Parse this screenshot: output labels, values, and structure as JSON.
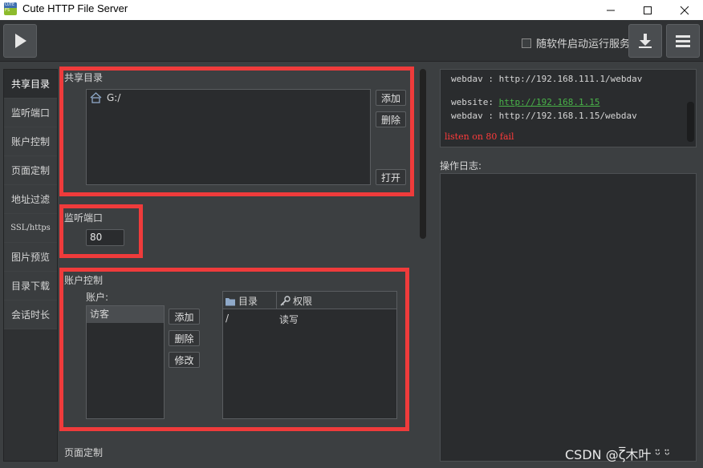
{
  "window": {
    "title": "Cute HTTP File Server",
    "icon_text": "CUTE FS",
    "minimize_glyph": "—",
    "maximize_glyph": "☐",
    "close_glyph": "✕"
  },
  "toolbar": {
    "autostart_label": "随软件启动运行服务",
    "autostart_checked": false,
    "play_icon": "play-icon",
    "download_icon": "download-icon",
    "menu_icon": "hamburger-menu-icon"
  },
  "sidebar": {
    "items": [
      {
        "label": "共享目录"
      },
      {
        "label": "监听端口"
      },
      {
        "label": "账户控制"
      },
      {
        "label": "页面定制"
      },
      {
        "label": "地址过滤"
      },
      {
        "label": "SSL/https"
      },
      {
        "label": "图片预览"
      },
      {
        "label": "目录下载"
      },
      {
        "label": "会话时长"
      }
    ],
    "active_index": 0
  },
  "shared_dirs": {
    "title": "共享目录",
    "entries": [
      {
        "icon": "home-icon",
        "path": "G:/"
      }
    ],
    "add_label": "添加",
    "delete_label": "删除",
    "open_label": "打开"
  },
  "listen_port": {
    "title": "监听端口",
    "value": "80"
  },
  "accounts": {
    "title": "账户控制",
    "accounts_label": "账户:",
    "users": [
      "访客"
    ],
    "add_label": "添加",
    "delete_label": "删除",
    "edit_label": "修改",
    "columns": [
      {
        "icon": "folder-icon",
        "label": "目录"
      },
      {
        "icon": "key-icon",
        "label": "权限"
      }
    ],
    "rows": [
      {
        "dir": "/",
        "perm": "读写"
      }
    ]
  },
  "page_custom": {
    "title": "页面定制"
  },
  "log": {
    "lines": [
      {
        "label": "webdav : ",
        "value": "http://192.168.111.1/webdav"
      },
      {
        "label": "website: ",
        "value": "http://192.168.1.15"
      },
      {
        "label": "webdav : ",
        "value": "http://192.168.1.15/webdav"
      }
    ],
    "error": "listen on 80 fail",
    "op_log_label": "操作日志:"
  },
  "watermark": "CSDN @ζ̅木叶 ᵕ̈ ᵕ̈",
  "colors": {
    "highlight_red": "#ef3b3b",
    "link_green": "#49b349",
    "error_red": "#ff3b3b"
  }
}
